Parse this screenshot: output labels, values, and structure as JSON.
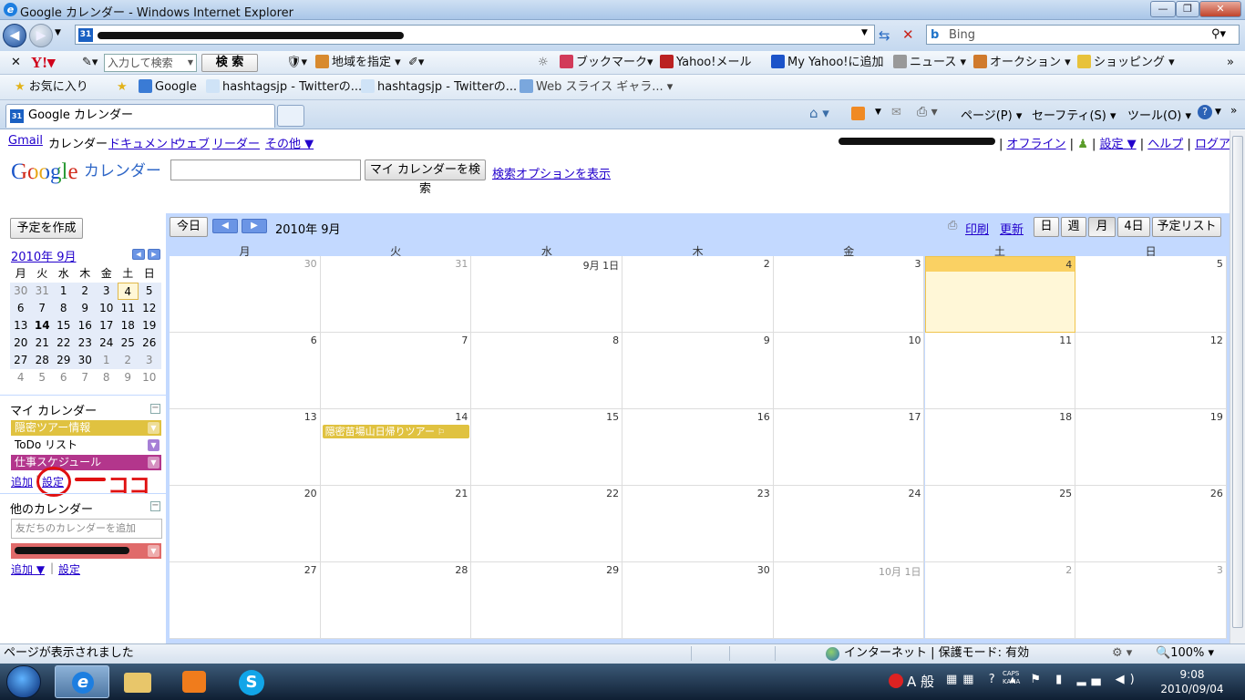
{
  "window": {
    "title": "Google カレンダー - Windows Internet Explorer"
  },
  "search_box": {
    "placeholder": "Bing"
  },
  "toolbar1": {
    "search_placeholder": "入力して検索",
    "search_button": "検 索",
    "items": [
      "地域を指定",
      "ブックマーク",
      "Yahoo!メール",
      "My Yahoo!に追加",
      "ニュース",
      "オークション",
      "ショッピング"
    ]
  },
  "favorites_bar": {
    "favorites": "お気に入り",
    "links": [
      "Google",
      "hashtagsjp - Twitterの...",
      "hashtagsjp - Twitterの...",
      "Web スライス ギャラ..."
    ]
  },
  "tab": {
    "label": "Google カレンダー"
  },
  "command_bar": {
    "page": "ページ(P)",
    "safety": "セーフティ(S)",
    "tools": "ツール(O)"
  },
  "gbar": {
    "links": [
      "Gmail",
      "カレンダー",
      "ドキュメント",
      "ウェブ",
      "リーダー",
      "その他 ▼"
    ],
    "right_links": [
      "オフライン",
      "設定 ▼",
      "ヘルプ",
      "ログアウト"
    ]
  },
  "header": {
    "logo_google": "Google",
    "logo_calendar": "カレンダー",
    "search_button": "マイ カレンダーを検索",
    "search_options": "検索オプションを表示"
  },
  "sidebar": {
    "create_button": "予定を作成",
    "mini_month": "2010年 9月",
    "weekdays": [
      "月",
      "火",
      "水",
      "木",
      "金",
      "土",
      "日"
    ],
    "mini_weeks": [
      [
        "30",
        "31",
        "1",
        "2",
        "3",
        "4",
        "5"
      ],
      [
        "6",
        "7",
        "8",
        "9",
        "10",
        "11",
        "12"
      ],
      [
        "13",
        "14",
        "15",
        "16",
        "17",
        "18",
        "19"
      ],
      [
        "20",
        "21",
        "22",
        "23",
        "24",
        "25",
        "26"
      ],
      [
        "27",
        "28",
        "29",
        "30",
        "1",
        "2",
        "3"
      ],
      [
        "4",
        "5",
        "6",
        "7",
        "8",
        "9",
        "10"
      ]
    ],
    "my_calendars_title": "マイ カレンダー",
    "my_calendars": [
      {
        "name": "隠密ツアー情報",
        "color": "#e0c240"
      },
      {
        "name": "ToDo リスト",
        "color": "#ffffff"
      },
      {
        "name": "仕事スケジュール",
        "color": "#b3368c"
      }
    ],
    "my_add": "追加",
    "my_settings": "設定",
    "annotation": "ココ",
    "other_calendars_title": "他のカレンダー",
    "friend_placeholder": "友だちのカレンダーを追加",
    "other_add": "追加 ▼",
    "other_settings": "設定"
  },
  "calendar": {
    "today_button": "今日",
    "month_label": "2010年 9月",
    "print": "印刷",
    "refresh": "更新",
    "views": [
      "日",
      "週",
      "月",
      "4日",
      "予定リスト"
    ],
    "weekdays": [
      "月",
      "火",
      "水",
      "木",
      "金",
      "土",
      "日"
    ],
    "weeks": [
      [
        "30",
        "31",
        "9月 1日",
        "2",
        "3",
        "4",
        "5"
      ],
      [
        "6",
        "7",
        "8",
        "9",
        "10",
        "11",
        "12"
      ],
      [
        "13",
        "14",
        "15",
        "16",
        "17",
        "18",
        "19"
      ],
      [
        "20",
        "21",
        "22",
        "23",
        "24",
        "25",
        "26"
      ],
      [
        "27",
        "28",
        "29",
        "30",
        "10月 1日",
        "2",
        "3"
      ]
    ],
    "event": {
      "title": "隠密苗場山日帰りツアー",
      "color": "#e0c240"
    }
  },
  "status_bar": {
    "left": "ページが表示されました",
    "zone": "インターネット | 保護モード: 有効",
    "zoom": "100%"
  },
  "taskbar": {
    "time": "9:08",
    "date": "2010/09/04",
    "ime": "A 般"
  }
}
